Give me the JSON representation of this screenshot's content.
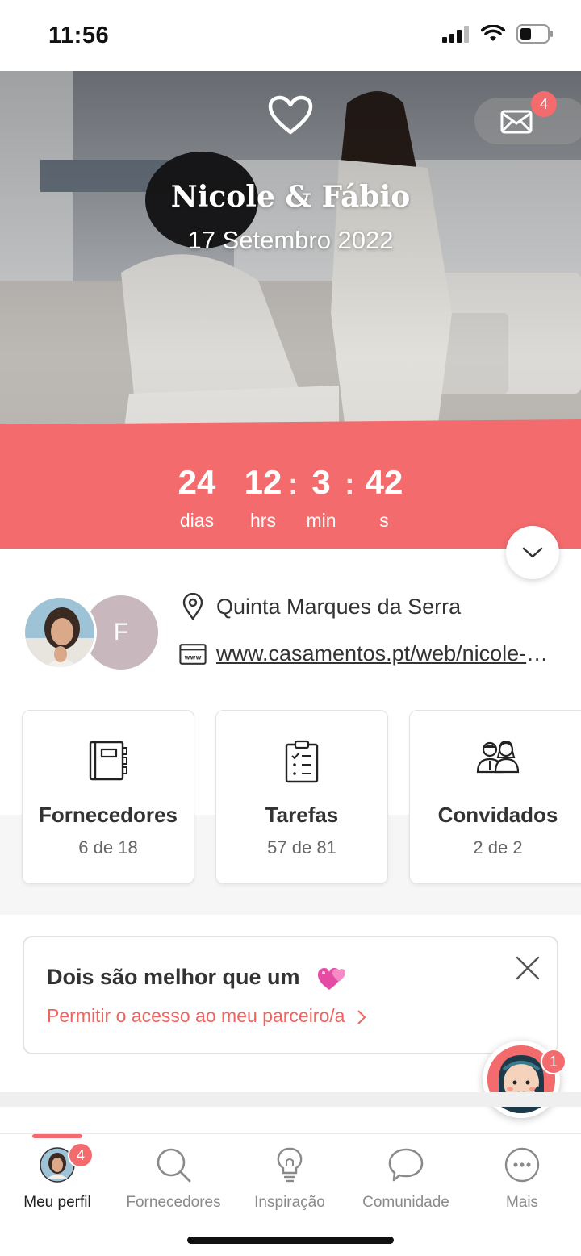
{
  "status_bar": {
    "time": "11:56"
  },
  "hero": {
    "names": "Nicole & Fábio",
    "date": "17 Setembro 2022",
    "mail_badge": "4"
  },
  "countdown": {
    "days": "24",
    "days_label": "dias",
    "hours": "12",
    "hours_label": "hrs",
    "minutes": "3",
    "minutes_label": "min",
    "seconds": "42",
    "seconds_label": "s"
  },
  "profile": {
    "partner_initial": "F",
    "venue": "Quinta Marques da Serra",
    "website": "www.casamentos.pt/web/nicole-e-fabio"
  },
  "cards": [
    {
      "title": "Fornecedores",
      "progress": "6 de 18"
    },
    {
      "title": "Tarefas",
      "progress": "57 de 81"
    },
    {
      "title": "Convidados",
      "progress": "2 de 2"
    }
  ],
  "partner_banner": {
    "title": "Dois são melhor que um",
    "link": "Permitir o acesso ao meu parceiro/a"
  },
  "assistant": {
    "badge": "1"
  },
  "tab_bar": {
    "profile_badge": "4",
    "items": [
      {
        "label": "Meu perfil"
      },
      {
        "label": "Fornecedores"
      },
      {
        "label": "Inspiração"
      },
      {
        "label": "Comunidade"
      },
      {
        "label": "Mais"
      }
    ]
  },
  "colors": {
    "accent": "#f46b6d",
    "link": "#f0645f"
  }
}
